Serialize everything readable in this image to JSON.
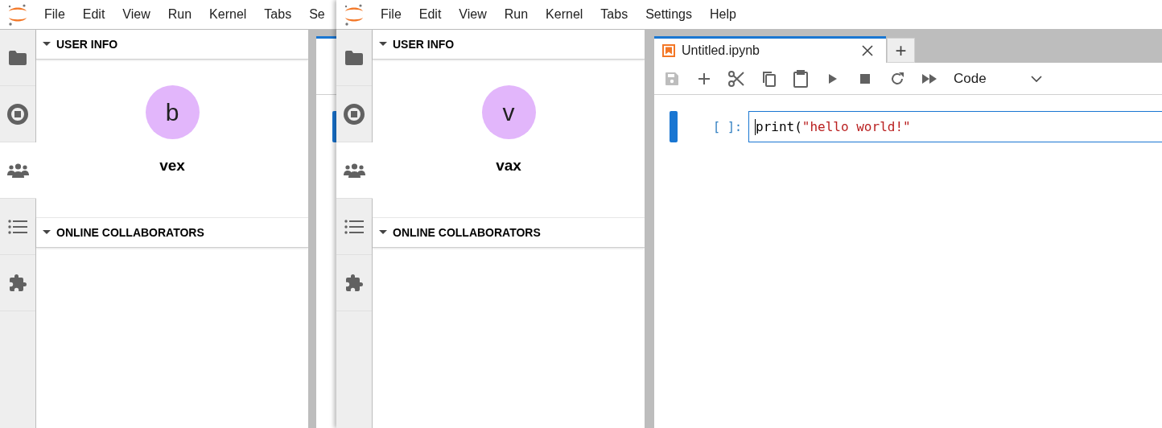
{
  "windows": [
    {
      "menu": [
        "File",
        "Edit",
        "View",
        "Run",
        "Kernel",
        "Tabs",
        "Se"
      ],
      "sidebar_tabs": [
        {
          "selected": false
        },
        {
          "selected": false
        },
        {
          "selected": true
        },
        {
          "selected": false
        },
        {
          "selected": false
        }
      ],
      "user_info": {
        "header": "USER INFO",
        "avatar_initial": "b",
        "color": "#e2b6fb",
        "name": "vex"
      },
      "collaborators": {
        "header": "ONLINE COLLABORATORS"
      }
    },
    {
      "menu": [
        "File",
        "Edit",
        "View",
        "Run",
        "Kernel",
        "Tabs",
        "Settings",
        "Help"
      ],
      "sidebar_tabs": [
        {
          "selected": false
        },
        {
          "selected": false
        },
        {
          "selected": true
        },
        {
          "selected": false
        },
        {
          "selected": false
        }
      ],
      "user_info": {
        "header": "USER INFO",
        "avatar_initial": "v",
        "color": "#e2b6fb",
        "name": "vax"
      },
      "collaborators": {
        "header": "ONLINE COLLABORATORS"
      },
      "notebook": {
        "tabs": [
          {
            "label": "Untitled.ipynb",
            "selected": true
          }
        ],
        "add_tab": "+",
        "toolbar": [
          {
            "disabled": true
          },
          {
            "disabled": false
          },
          {
            "disabled": false
          },
          {
            "disabled": false
          },
          {
            "disabled": false
          },
          {
            "disabled": false
          },
          {
            "disabled": false
          },
          {
            "disabled": false
          },
          {
            "disabled": false
          }
        ],
        "cell_type": "Code",
        "cell": {
          "prompt": "[ ]:",
          "selected": true,
          "code": [
            {
              "kind": "name",
              "text": "print("
            },
            {
              "kind": "string",
              "text": "\"hello world!\""
            }
          ]
        }
      }
    }
  ]
}
